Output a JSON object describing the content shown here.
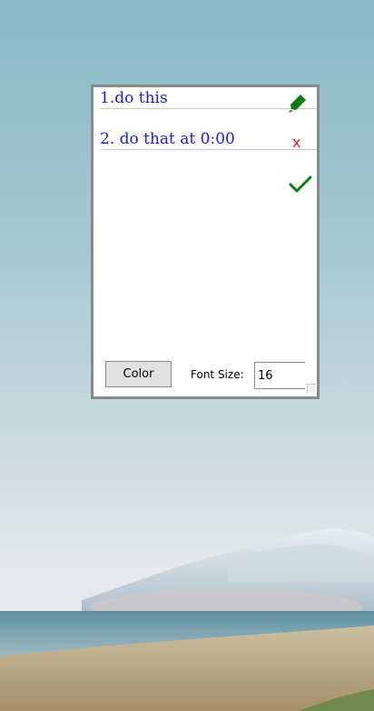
{
  "note": {
    "lines": [
      {
        "text": "1.do this"
      },
      {
        "text": "2. do that at 0:00"
      }
    ],
    "icons": {
      "edit": "pen-icon",
      "delete": "close-icon",
      "done": "check-icon"
    },
    "delete_glyph": "x",
    "color_button_label": "Color",
    "font_size_label": "Font Size:",
    "font_size_value": "16"
  },
  "colors": {
    "text": "#1a1adb",
    "icon_green": "#0a7d0a",
    "delete_red": "#e02020"
  }
}
